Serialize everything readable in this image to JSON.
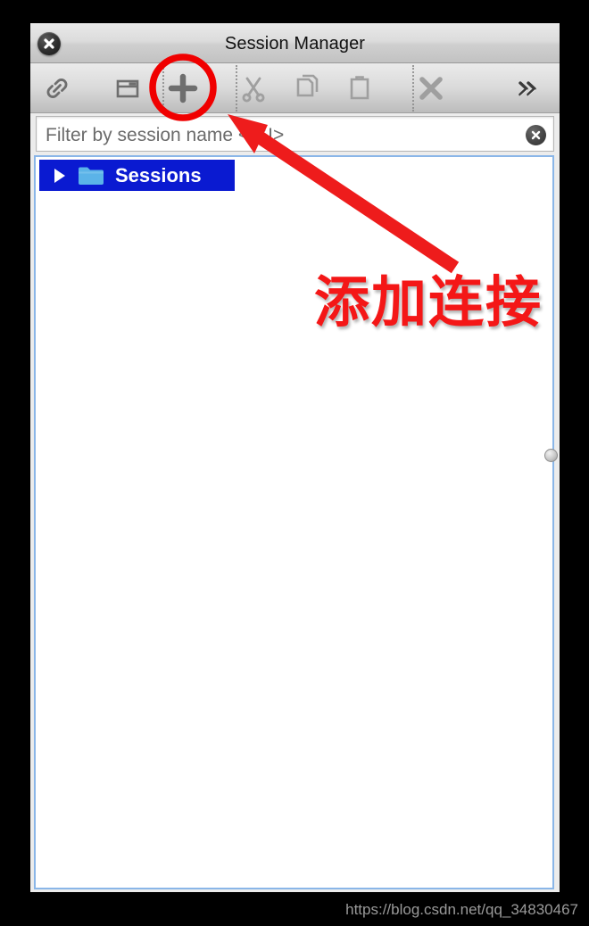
{
  "window": {
    "title": "Session Manager",
    "close_button_label": "Close"
  },
  "toolbar": {
    "buttons": [
      {
        "name": "connect-icon",
        "label": "Connect",
        "icon": "chain-link-icon"
      },
      {
        "name": "new-window-icon",
        "label": "New Window",
        "icon": "window-icon"
      },
      {
        "name": "add-icon",
        "label": "Add Session",
        "icon": "plus-icon"
      },
      {
        "name": "cut-icon",
        "label": "Cut",
        "icon": "scissors-icon"
      },
      {
        "name": "copy-icon",
        "label": "Copy",
        "icon": "copy-pages-icon"
      },
      {
        "name": "paste-icon",
        "label": "Paste",
        "icon": "clipboard-icon"
      },
      {
        "name": "delete-icon",
        "label": "Delete",
        "icon": "x-mark-icon"
      },
      {
        "name": "overflow-icon",
        "label": "More",
        "icon": "double-chevron-right-icon"
      }
    ]
  },
  "filter": {
    "placeholder": "Filter by session name <⌘I>",
    "value": "",
    "clear_label": "Clear"
  },
  "tree": {
    "items": [
      {
        "label": "Sessions",
        "expanded": false,
        "selected": true,
        "icon": "folder-icon"
      }
    ]
  },
  "annotation": {
    "text": "添加连接",
    "arrow_color": "#ee1c1c",
    "highlight_color": "#f00000",
    "highlight_target": "add-icon"
  },
  "watermark": {
    "text": "https://blog.csdn.net/qq_34830467"
  },
  "colors": {
    "selection_blue": "#0a1ad1",
    "panel_border_blue": "#8ab6e8",
    "folder_blue": "#5bb3e8",
    "icon_gray": "#6e6e6e",
    "icon_gray_pale": "#9f9f9f",
    "annotation_red": "#f41717"
  }
}
